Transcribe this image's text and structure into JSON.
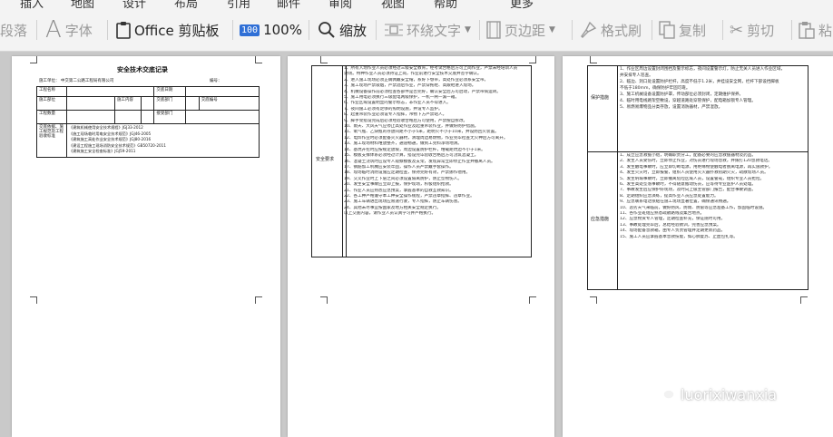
{
  "toolbar": {
    "top_menu": [
      "插入",
      "地图",
      "设计",
      "布局",
      "引用",
      "邮件",
      "审阅",
      "视图",
      "帮助",
      "更多"
    ],
    "paragraph_label": "段落",
    "font_label": "字体",
    "clipboard_label": "Office 剪贴板",
    "zoom_badge": "100",
    "zoom_label": "100%",
    "zoom_tool_label": "缩放",
    "wrap_text_label": "环绕文字",
    "margins_label": "页边距",
    "format_painter_label": "格式刷",
    "copy_label": "复制",
    "cut_label": "剪切",
    "paste_label": "粘"
  },
  "page1": {
    "title": "安全技术交底记录",
    "subtitle": "施工单位：  中交第二公路工程局有限公司",
    "number_label": "编号：",
    "row1": [
      "工程名称",
      "",
      "交底日期",
      ""
    ],
    "row2": [
      "施工部位",
      "",
      "施工内容",
      "",
      "交底部门",
      "",
      "交底编号",
      ""
    ],
    "row3": [
      "工程数量",
      "",
      "",
      "",
      "接受部门",
      ""
    ],
    "basis_label": "交底依据、施工规范及工程验收标准",
    "basis_lines": [
      "《建筑机械使用安全技术规程》JGJ33-2012",
      "《施工现场临时用电安全技术规范》JGJ46-2005",
      "《建筑施工高处作业安全技术规范》JGJ80-2016",
      "《建设工程施工现场消防安全技术规范》GB50720-2011",
      "《建筑施工安全检查标准》JGJ59-2011"
    ]
  },
  "page2": {
    "label": "安全要求",
    "lines": [
      "1、所有入场作业人员必须经过三级安全教育，经考试合格后方可上岗作业，严禁未经培训人员",
      "进场。特种作业人员必须持证上岗，作业前进行安全技术交底并签字确认。",
      "2、进入施工现场必须正确佩戴安全帽，系好下颚带，高处作业必须系安全带。",
      "3、施工现场严禁吸烟，严禁酒后作业，严禁穿拖鞋、高跟鞋进入现场。",
      "4、机械设备操作前必须检查各部件是否完好，确认安全后方可启动，严禁带病运转。",
      "5、施工用电必须执行三级配电两级保护，一机一闸一漏一箱。",
      "6、作业区域设置明显的警示标志，非作业人员不得进入。",
      "7、夜间施工必须有足够的照明设施，并设专人监护。",
      "8、起重吊装作业必须设专人指挥，吊物下方严禁站人。",
      "9、脚手架搭设完成后必须经验收合格后方可使用，严禁擅自拆改。",
      "10、雨天、大风天气应停止高处作业及起重吊装作业，并做好防护措施。",
      "11、氧气瓶、乙炔瓶的存放间距不小于5米，距明火不小于10米，并设防回火装置。",
      "12、电焊作业时必须配备灭火器材，清理周边易燃物，作业完毕检查无火种后方可离开。",
      "13、施工现场材料堆放整齐，通道畅通，做到工完料净场地清。",
      "14、基坑开挖时应按规定放坡，周边设置防护栏杆，堆载距坑边不小于1米。",
      "15、模板支撑体系必须经过计算，搭设完毕验收合格后方可浇筑混凝土。",
      "16、混凝土浇筑时应设专人观察模板及支架，发现异常立即停止作业并撤离人员。",
      "17、钢筋加工机械应安装牢固，操作人员严禁戴手套操作。",
      "18、现场临时消防设施应定期检查，保持完好有效，严禁挪作他用。",
      "19、交叉作业时上下层之间必须设置隔离防护，防止坠物伤人。",
      "20、发生安全事故应立即上报，保护现场，积极组织抢救。",
      "21、作业人员应熟悉应急预案，掌握基本的自救互救知识。",
      "22、各工种严格遵守本工种安全操作规程，严禁违章指挥、违章作业。",
      "23、施工车辆进出现场应限速行驶，专人指挥，防止车辆伤害。",
      "24、其他未尽事宜按国家及地方相关安全规定执行。",
      "以上交底内容，请作业人员认真学习并严格执行。"
    ]
  },
  "page3": {
    "label1": "保护措施",
    "label2": "应急措施",
    "lines1": [
      "1、作业区周边设置封闭围挡及警示标志，夜间设置警示灯，防止无关人员进入作业区域，",
      "并安排专人巡查。",
      "2、临边、洞口处设置防护栏杆，高度不低于1.2米，并挂设安全网，栏杆下部设挡脚板",
      "不低于180mm，确保防护牢固可靠。",
      "3、施工机械设备设置防护罩，传动部位必须封闭，定期维护保养。",
      "4、临时用电线路架空敷设，穿越道路处穿管保护，配电箱加锁专人管理。",
      "5、易燃易爆物品分类存放，设置消防器材，严禁混放。"
    ],
    "lines2": [
      "1、成立应急救援小组，明确职责分工，配备必要的应急救援器材及药品。",
      "2、发生人员受伤时，立即停止作业，对伤员进行现场急救，并拨打120急救电话。",
      "3、发生触电事故时，应立即切断电源，用绝缘物使触电者脱离电源，再实施救护。",
      "4、发生火灾时，立即报警，组织人员使用灭火器扑救初期火灾，疏散现场人员。",
      "5、发生坍塌事故时，立即撤离危险区域人员，设置警戒，组织专业人员抢险。",
      "6、发生高处坠落事故时，不得随意搬动伤员，应等待专业医护人员处理。",
      "7、事故发生后应保护好现场，及时向上级主管部门报告，配合事故调查。",
      "8、定期组织应急演练，提高作业人员应急处置能力。",
      "9、应急联系电话张贴在施工现场显著位置，确保通讯畅通。",
      "10、恶劣天气来临前，做好防风、防雨、防雷等应急准备工作，加固临时设施。",
      "11、各作业班组应熟悉疏散路线及集合地点。",
      "12、应急物资专人管理，定期检查补充，保证随时可用。",
      "13、事故处理完毕后，总结经验教训，完善应急预案。",
      "14、现场配备急救箱，由专人负责管理并定期更新药品。",
      "15、施工人员应掌握基本急救技能，如心肺复苏、止血包扎等。"
    ]
  },
  "watermark": {
    "text": "luorixiwanxia"
  }
}
